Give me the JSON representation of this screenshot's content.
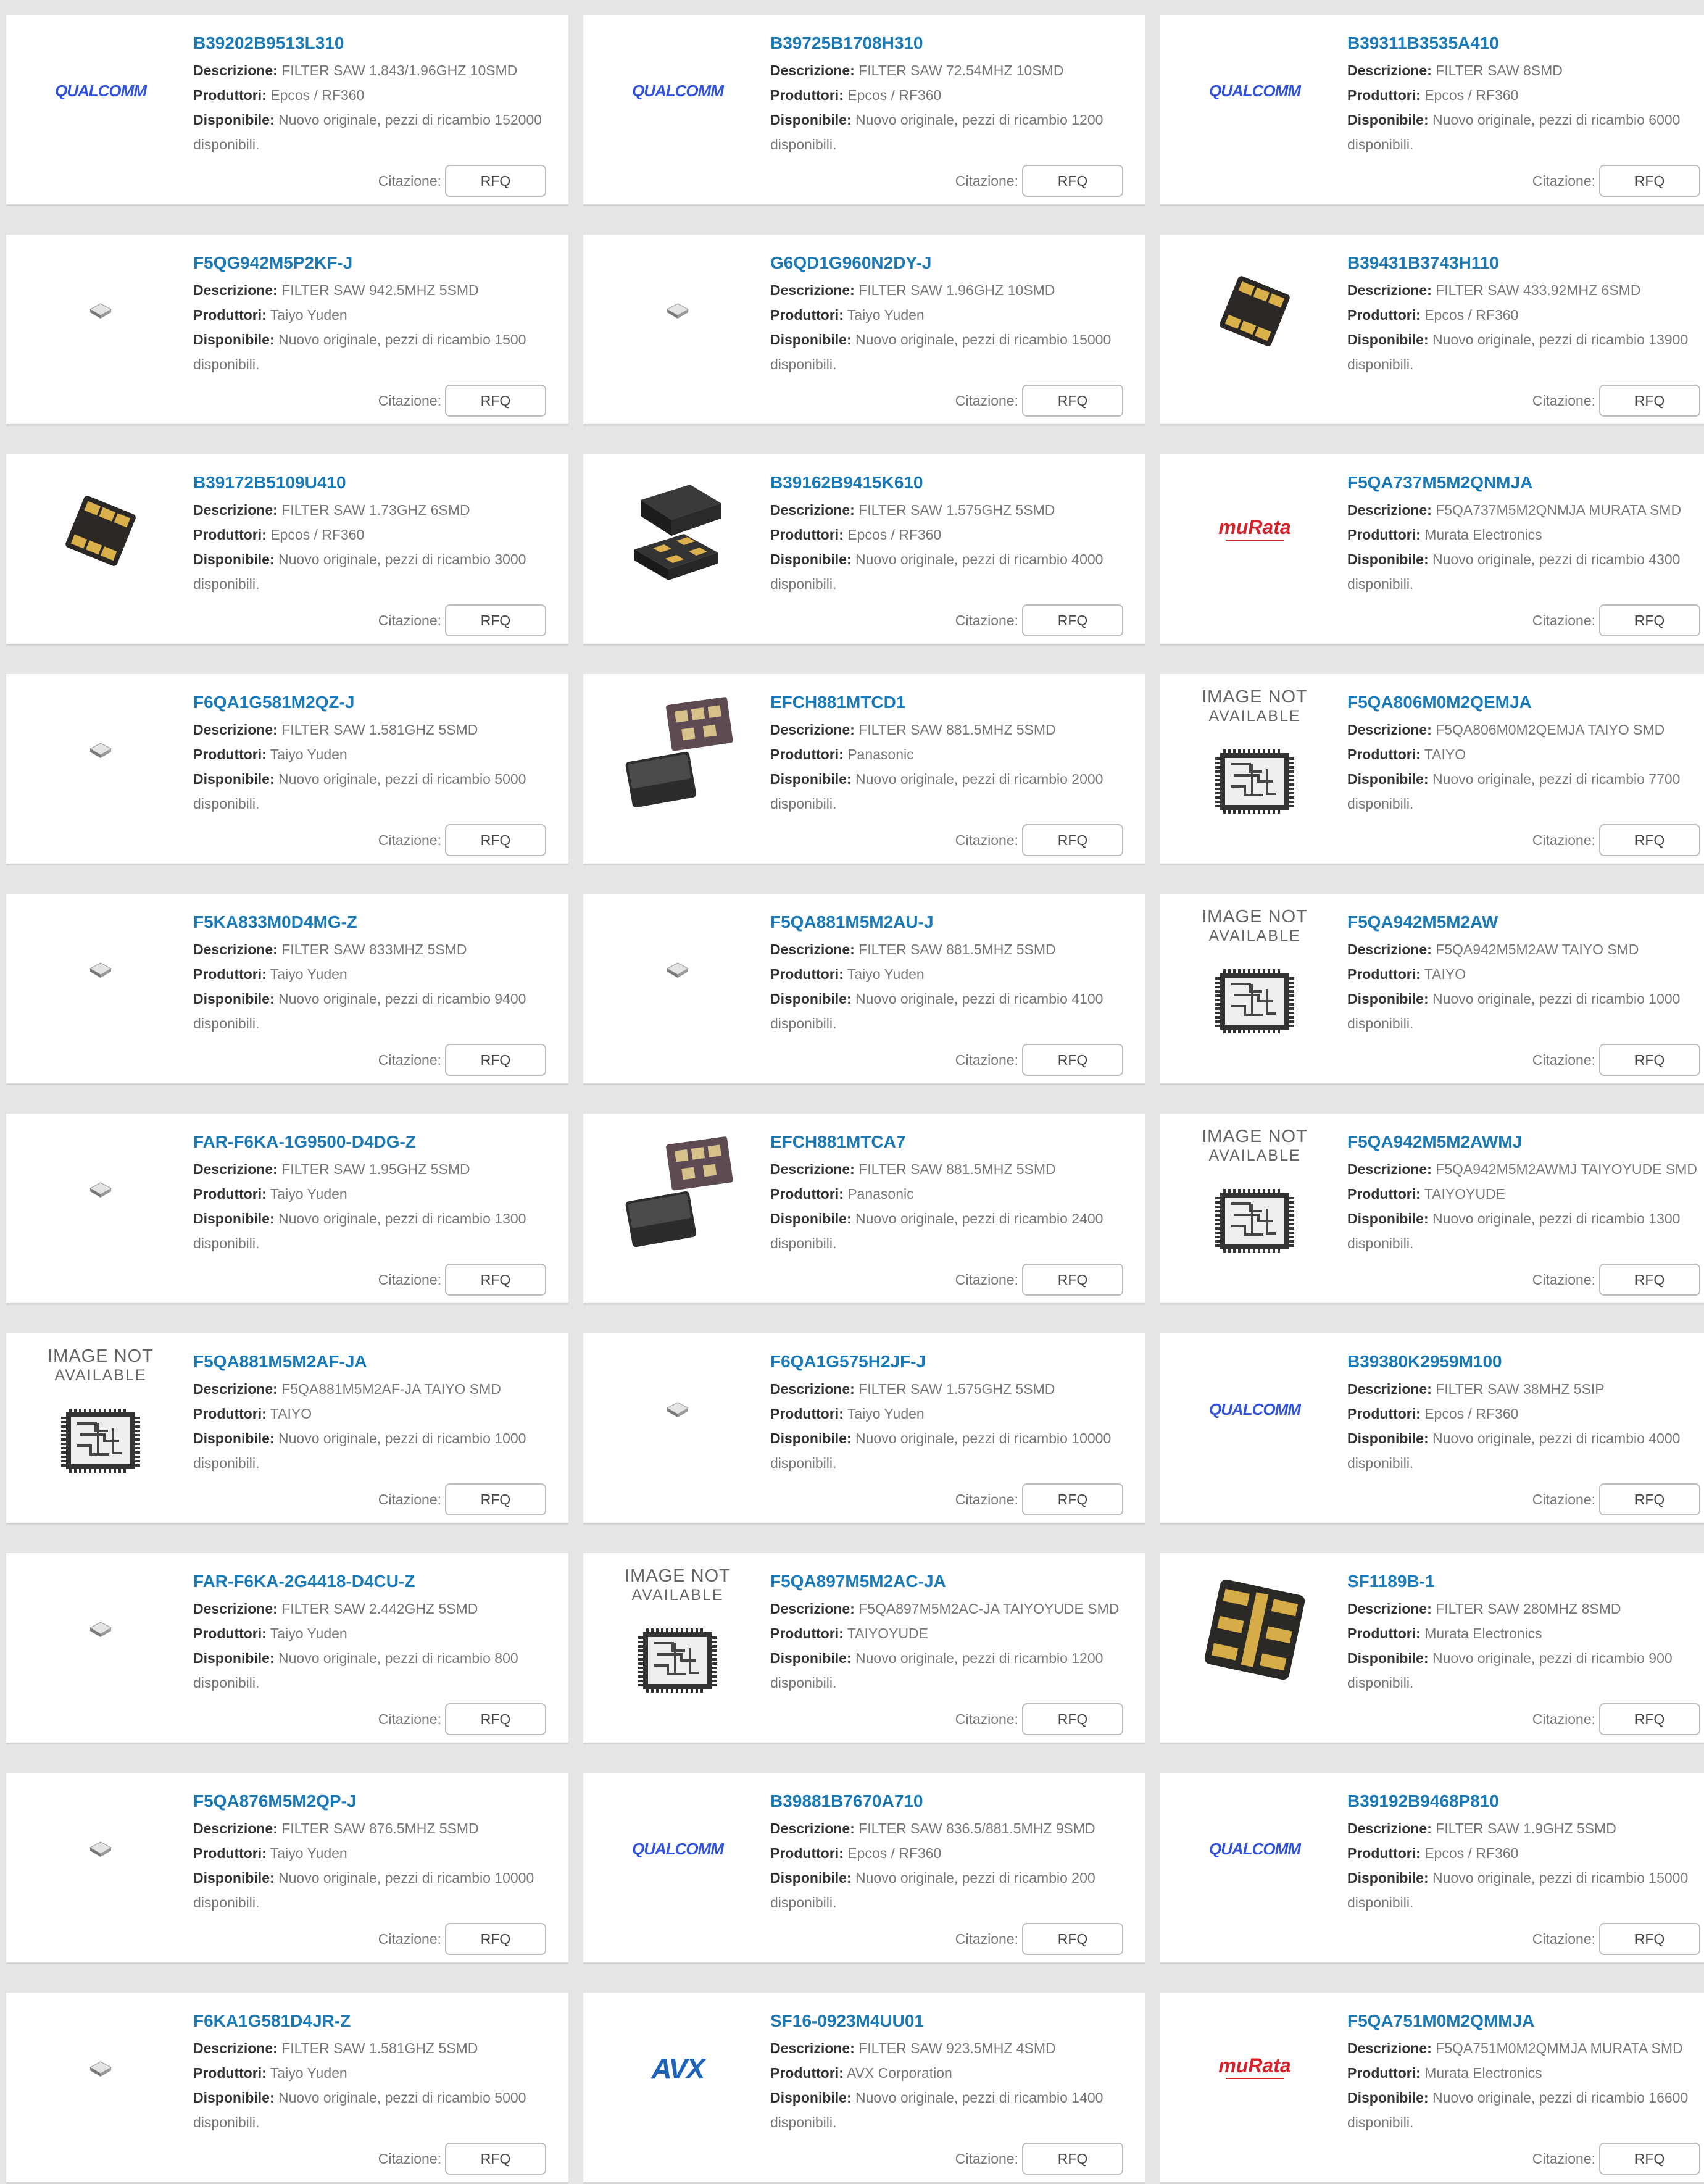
{
  "labels": {
    "descrizione": "Descrizione:",
    "produttori": "Produttori:",
    "disponibile": "Disponibile:",
    "citazione": "Citazione:",
    "rfq": "RFQ",
    "image_not_available_line1": "IMAGE NOT",
    "image_not_available_line2": "AVAILABLE"
  },
  "colors": {
    "link": "#1a7ab8",
    "qualcomm": "#3253dc",
    "murata": "#d2232a",
    "avx": "#1f63b8"
  },
  "products": [
    {
      "part": "B39202B9513L310",
      "desc": "FILTER SAW 1.843/1.96GHZ 10SMD",
      "mfr": "Epcos / RF360",
      "avail": "Nuovo originale, pezzi di ricambio 152000 disponibili.",
      "image": "qualcomm-logo"
    },
    {
      "part": "B39725B1708H310",
      "desc": "FILTER SAW 72.54MHZ 10SMD",
      "mfr": "Epcos / RF360",
      "avail": "Nuovo originale, pezzi di ricambio 1200 disponibili.",
      "image": "qualcomm-logo"
    },
    {
      "part": "B39311B3535A410",
      "desc": "FILTER SAW 8SMD",
      "mfr": "Epcos / RF360",
      "avail": "Nuovo originale, pezzi di ricambio 6000 disponibili.",
      "image": "qualcomm-logo"
    },
    {
      "part": "F5QG942M5P2KF-J",
      "desc": "FILTER SAW 942.5MHZ 5SMD",
      "mfr": "Taiyo Yuden",
      "avail": "Nuovo originale, pezzi di ricambio 1500 disponibili.",
      "image": "small-chip"
    },
    {
      "part": "G6QD1G960N2DY-J",
      "desc": "FILTER SAW 1.96GHZ 10SMD",
      "mfr": "Taiyo Yuden",
      "avail": "Nuovo originale, pezzi di ricambio 15000 disponibili.",
      "image": "small-chip"
    },
    {
      "part": "B39431B3743H110",
      "desc": "FILTER SAW 433.92MHZ 6SMD",
      "mfr": "Epcos / RF360",
      "avail": "Nuovo originale, pezzi di ricambio 13900 disponibili.",
      "image": "gold-pad-chip"
    },
    {
      "part": "B39172B5109U410",
      "desc": "FILTER SAW 1.73GHZ 6SMD",
      "mfr": "Epcos / RF360",
      "avail": "Nuovo originale, pezzi di ricambio 3000 disponibili.",
      "image": "gold-pad-chip"
    },
    {
      "part": "B39162B9415K610",
      "desc": "FILTER SAW 1.575GHZ 5SMD",
      "mfr": "Epcos / RF360",
      "avail": "Nuovo originale, pezzi di ricambio 4000 disponibili.",
      "image": "black-package-pair"
    },
    {
      "part": "F5QA737M5M2QNMJA",
      "desc": "F5QA737M5M2QNMJA MURATA SMD",
      "mfr": "Murata Electronics",
      "avail": "Nuovo originale, pezzi di ricambio 4300 disponibili.",
      "image": "murata-logo"
    },
    {
      "part": "F6QA1G581M2QZ-J",
      "desc": "FILTER SAW 1.581GHZ 5SMD",
      "mfr": "Taiyo Yuden",
      "avail": "Nuovo originale, pezzi di ricambio 5000 disponibili.",
      "image": "small-chip"
    },
    {
      "part": "EFCH881MTCD1",
      "desc": "FILTER SAW 881.5MHZ 5SMD",
      "mfr": "Panasonic",
      "avail": "Nuovo originale, pezzi di ricambio 2000 disponibili.",
      "image": "panasonic-chip-pair"
    },
    {
      "part": "F5QA806M0M2QEMJA",
      "desc": "F5QA806M0M2QEMJA TAIYO SMD",
      "mfr": "TAIYO",
      "avail": "Nuovo originale, pezzi di ricambio 7700 disponibili.",
      "image": "image-not-available"
    },
    {
      "part": "F5KA833M0D4MG-Z",
      "desc": "FILTER SAW 833MHZ 5SMD",
      "mfr": "Taiyo Yuden",
      "avail": "Nuovo originale, pezzi di ricambio 9400 disponibili.",
      "image": "small-chip"
    },
    {
      "part": "F5QA881M5M2AU-J",
      "desc": "FILTER SAW 881.5MHZ 5SMD",
      "mfr": "Taiyo Yuden",
      "avail": "Nuovo originale, pezzi di ricambio 4100 disponibili.",
      "image": "small-chip"
    },
    {
      "part": "F5QA942M5M2AW",
      "desc": "F5QA942M5M2AW TAIYO SMD",
      "mfr": "TAIYO",
      "avail": "Nuovo originale, pezzi di ricambio 1000 disponibili.",
      "image": "image-not-available"
    },
    {
      "part": "FAR-F6KA-1G9500-D4DG-Z",
      "desc": "FILTER SAW 1.95GHZ 5SMD",
      "mfr": "Taiyo Yuden",
      "avail": "Nuovo originale, pezzi di ricambio 1300 disponibili.",
      "image": "small-chip"
    },
    {
      "part": "EFCH881MTCA7",
      "desc": "FILTER SAW 881.5MHZ 5SMD",
      "mfr": "Panasonic",
      "avail": "Nuovo originale, pezzi di ricambio 2400 disponibili.",
      "image": "panasonic-chip-pair"
    },
    {
      "part": "F5QA942M5M2AWMJ",
      "desc": "F5QA942M5M2AWMJ TAIYOYUDE SMD",
      "mfr": "TAIYOYUDE",
      "avail": "Nuovo originale, pezzi di ricambio 1300 disponibili.",
      "image": "image-not-available"
    },
    {
      "part": "F5QA881M5M2AF-JA",
      "desc": "F5QA881M5M2AF-JA TAIYO SMD",
      "mfr": "TAIYO",
      "avail": "Nuovo originale, pezzi di ricambio 1000 disponibili.",
      "image": "image-not-available"
    },
    {
      "part": "F6QA1G575H2JF-J",
      "desc": "FILTER SAW 1.575GHZ 5SMD",
      "mfr": "Taiyo Yuden",
      "avail": "Nuovo originale, pezzi di ricambio 10000 disponibili.",
      "image": "small-chip"
    },
    {
      "part": "B39380K2959M100",
      "desc": "FILTER SAW 38MHZ 5SIP",
      "mfr": "Epcos / RF360",
      "avail": "Nuovo originale, pezzi di ricambio 4000 disponibili.",
      "image": "qualcomm-logo"
    },
    {
      "part": "FAR-F6KA-2G4418-D4CU-Z",
      "desc": "FILTER SAW 2.442GHZ 5SMD",
      "mfr": "Taiyo Yuden",
      "avail": "Nuovo originale, pezzi di ricambio 800 disponibili.",
      "image": "small-chip"
    },
    {
      "part": "F5QA897M5M2AC-JA",
      "desc": "F5QA897M5M2AC-JA TAIYOYUDE SMD",
      "mfr": "TAIYOYUDE",
      "avail": "Nuovo originale, pezzi di ricambio 1200 disponibili.",
      "image": "image-not-available"
    },
    {
      "part": "SF1189B-1",
      "desc": "FILTER SAW 280MHZ 8SMD",
      "mfr": "Murata Electronics",
      "avail": "Nuovo originale, pezzi di ricambio 900 disponibili.",
      "image": "large-gold-pad-chip"
    },
    {
      "part": "F5QA876M5M2QP-J",
      "desc": "FILTER SAW 876.5MHZ 5SMD",
      "mfr": "Taiyo Yuden",
      "avail": "Nuovo originale, pezzi di ricambio 10000 disponibili.",
      "image": "small-chip"
    },
    {
      "part": "B39881B7670A710",
      "desc": "FILTER SAW 836.5/881.5MHZ 9SMD",
      "mfr": "Epcos / RF360",
      "avail": "Nuovo originale, pezzi di ricambio 200 disponibili.",
      "image": "qualcomm-logo"
    },
    {
      "part": "B39192B9468P810",
      "desc": "FILTER SAW 1.9GHZ 5SMD",
      "mfr": "Epcos / RF360",
      "avail": "Nuovo originale, pezzi di ricambio 15000 disponibili.",
      "image": "qualcomm-logo"
    },
    {
      "part": "F6KA1G581D4JR-Z",
      "desc": "FILTER SAW 1.581GHZ 5SMD",
      "mfr": "Taiyo Yuden",
      "avail": "Nuovo originale, pezzi di ricambio 5000 disponibili.",
      "image": "small-chip"
    },
    {
      "part": "SF16-0923M4UU01",
      "desc": "FILTER SAW 923.5MHZ 4SMD",
      "mfr": "AVX Corporation",
      "avail": "Nuovo originale, pezzi di ricambio 1400 disponibili.",
      "image": "avx-logo"
    },
    {
      "part": "F5QA751M0M2QMMJA",
      "desc": "F5QA751M0M2QMMJA MURATA SMD",
      "mfr": "Murata Electronics",
      "avail": "Nuovo originale, pezzi di ricambio 16600 disponibili.",
      "image": "murata-logo"
    }
  ]
}
